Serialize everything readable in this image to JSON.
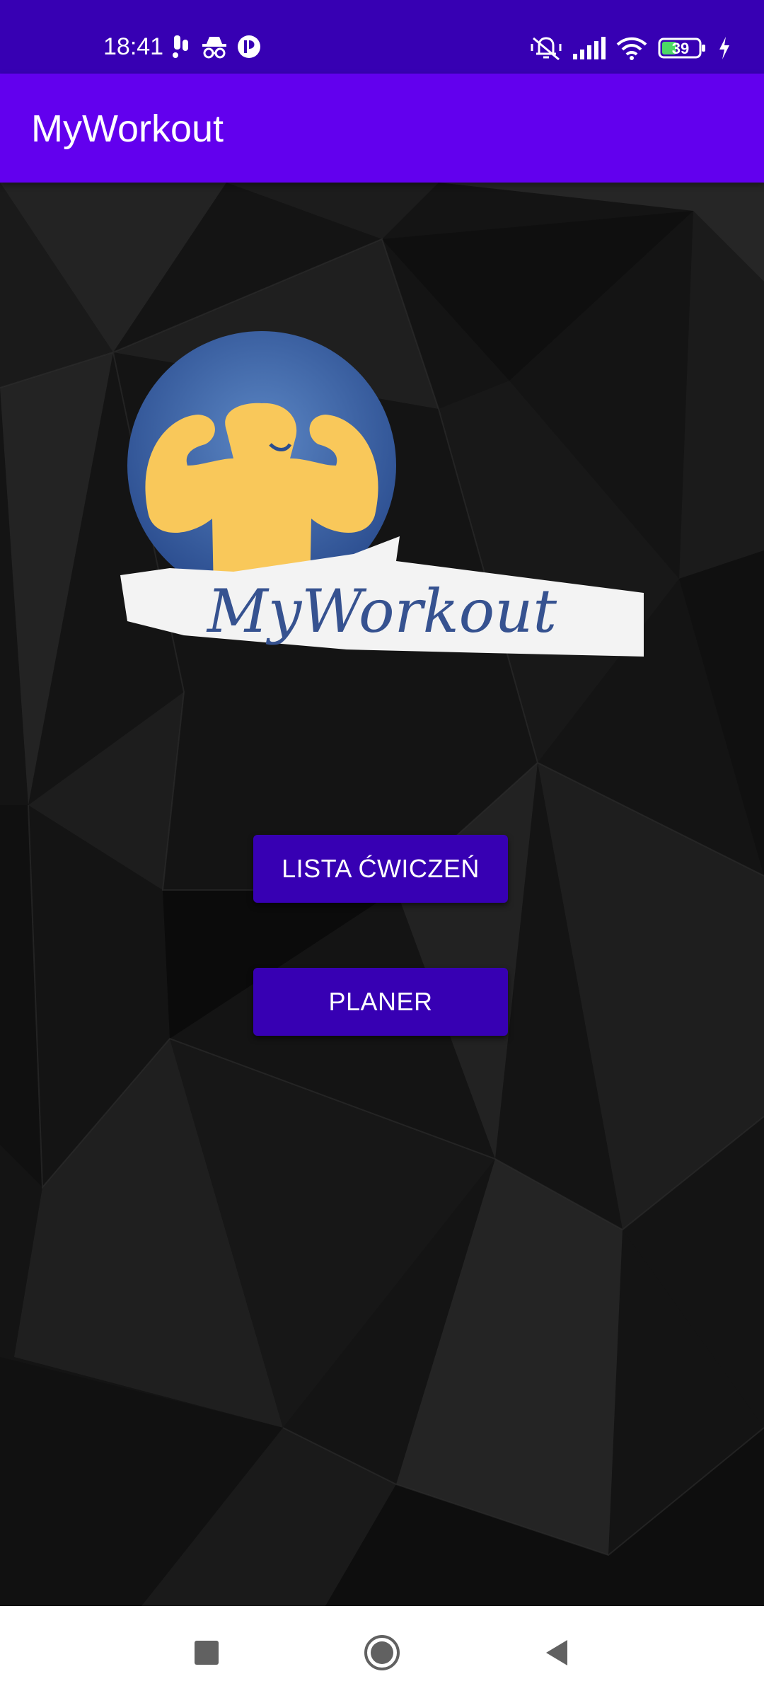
{
  "status_bar": {
    "time": "18:41",
    "battery_level": "39",
    "left_icons": [
      "vibrate-notification-icon",
      "incognito-icon",
      "app-notification-icon"
    ],
    "right_icons": [
      "silent-mode-icon",
      "signal-icon",
      "wifi-icon",
      "battery-icon",
      "charging-icon"
    ],
    "background_color": "#3700b3"
  },
  "app_bar": {
    "title": "MyWorkout",
    "background_color": "#6200ee"
  },
  "logo": {
    "text": "MyWorkout",
    "icon": "flexing-man-logo"
  },
  "buttons": {
    "exercise_list": "LISTA ĆWICZEŃ",
    "planner": "PLANER",
    "color": "#3700b3"
  },
  "nav_bar": {
    "items": [
      "recents-square",
      "home-circle",
      "back-triangle"
    ]
  }
}
